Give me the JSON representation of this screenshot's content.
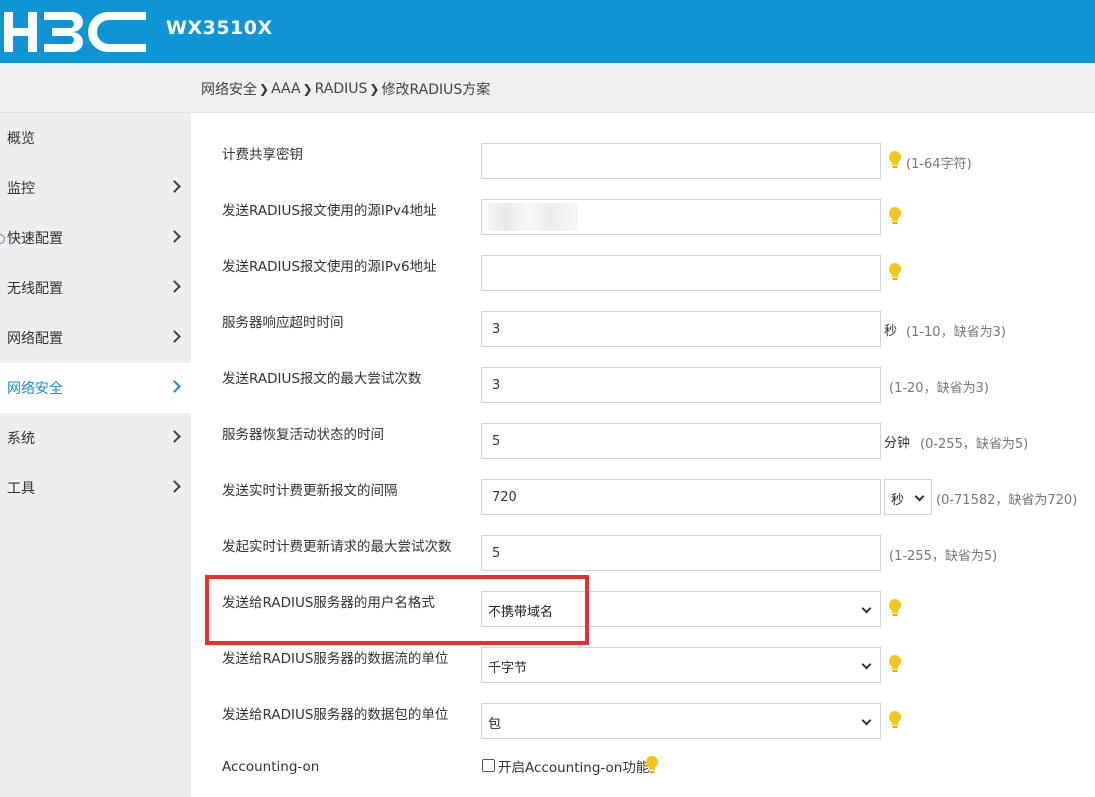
{
  "header": {
    "logo_text": "H3C",
    "model": "WX3510X",
    "bg_color": "#0f95d6"
  },
  "breadcrumb": [
    "网络安全",
    "AAA",
    "RADIUS",
    "修改RADIUS方案"
  ],
  "sidebar": {
    "items": [
      {
        "label": "概览",
        "has_chevron": false,
        "active": false
      },
      {
        "label": "监控",
        "has_chevron": true,
        "active": false
      },
      {
        "label": "快速配置",
        "has_chevron": true,
        "active": false
      },
      {
        "label": "无线配置",
        "has_chevron": true,
        "active": false
      },
      {
        "label": "网络配置",
        "has_chevron": true,
        "active": false
      },
      {
        "label": "网络安全",
        "has_chevron": true,
        "active": true
      },
      {
        "label": "系统",
        "has_chevron": true,
        "active": false
      },
      {
        "label": "工具",
        "has_chevron": true,
        "active": false
      }
    ],
    "active_color": "#1a8fd0"
  },
  "form": {
    "acct_shared_key": {
      "label": "计费共享密钥",
      "value": "",
      "hint": "(1-64字符)"
    },
    "src_ipv4": {
      "label": "发送RADIUS报文使用的源IPv4地址",
      "value": ""
    },
    "src_ipv6": {
      "label": "发送RADIUS报文使用的源IPv6地址",
      "value": ""
    },
    "resp_timeout": {
      "label": "服务器响应超时时间",
      "value": "3",
      "unit": "秒",
      "hint": "(1-10，缺省为3)"
    },
    "max_retries": {
      "label": "发送RADIUS报文的最大尝试次数",
      "value": "3",
      "hint": "(1-20，缺省为3)"
    },
    "quiet_time": {
      "label": "服务器恢复活动状态的时间",
      "value": "5",
      "unit": "分钟",
      "hint": "(0-255，缺省为5)"
    },
    "realtime_interval": {
      "label": "发送实时计费更新报文的间隔",
      "value": "720",
      "unit_select": "秒",
      "hint": "(0-71582，缺省为720)"
    },
    "realtime_retries": {
      "label": "发起实时计费更新请求的最大尝试次数",
      "value": "5",
      "hint": "(1-255，缺省为5)"
    },
    "username_format": {
      "label": "发送给RADIUS服务器的用户名格式",
      "value": "不携带域名"
    },
    "data_flow_unit": {
      "label": "发送给RADIUS服务器的数据流的单位",
      "value": "千字节"
    },
    "packet_unit": {
      "label": "发送给RADIUS服务器的数据包的单位",
      "value": "包"
    },
    "accounting_on": {
      "label": "Accounting-on",
      "checkbox_label": "开启Accounting-on功能",
      "checked": false
    }
  },
  "highlight_color": "#ef2d2d",
  "bulb_color": "#f5c518"
}
